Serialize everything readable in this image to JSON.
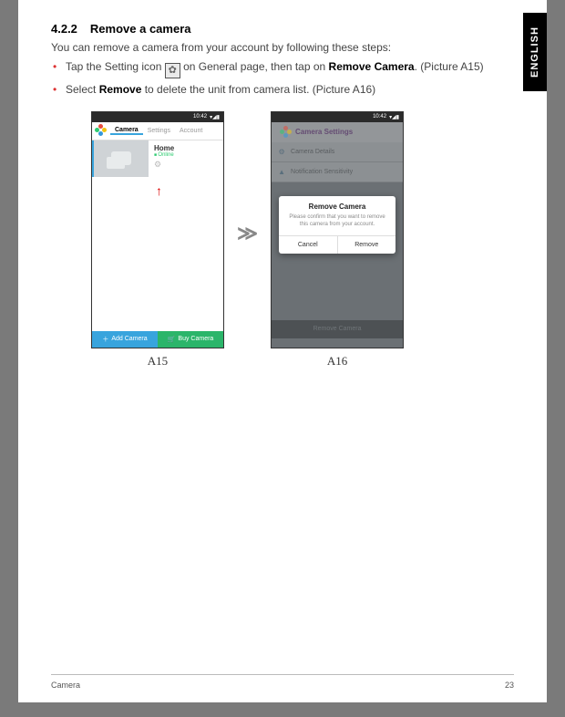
{
  "lang_tab": "ENGLISH",
  "section": {
    "number": "4.2.2",
    "title": "Remove a camera"
  },
  "intro": "You can remove a camera from your account by following these steps:",
  "step1_a": "Tap the Setting icon ",
  "step1_b": " on General page, then tap on ",
  "step1_bold": "Remove Camera",
  "step1_c": ". (Picture A15)",
  "step2_a": "Select ",
  "step2_bold": "Remove",
  "step2_b": " to delete the unit from camera list. (Picture A16)",
  "phoneA": {
    "time": "10:42",
    "signal": "▾◢▮",
    "tabs": {
      "camera": "Camera",
      "settings": "Settings",
      "account": "Account"
    },
    "cam_name": "Home",
    "cam_status": "Online",
    "add": "Add Camera",
    "buy": "Buy Camera"
  },
  "phoneB": {
    "time": "10:42",
    "signal": "▾◢▮",
    "header": "Camera Settings",
    "row_details": "Camera Details",
    "row_notif": "Notification Sensitivity",
    "modal": {
      "title": "Remove Camera",
      "msg": "Please confirm that you want to remove this camera from your account.",
      "cancel": "Cancel",
      "remove": "Remove"
    },
    "bottom": "Remove Camera"
  },
  "captions": {
    "a": "A15",
    "b": "A16"
  },
  "footer": {
    "left": "Camera",
    "right": "23"
  }
}
